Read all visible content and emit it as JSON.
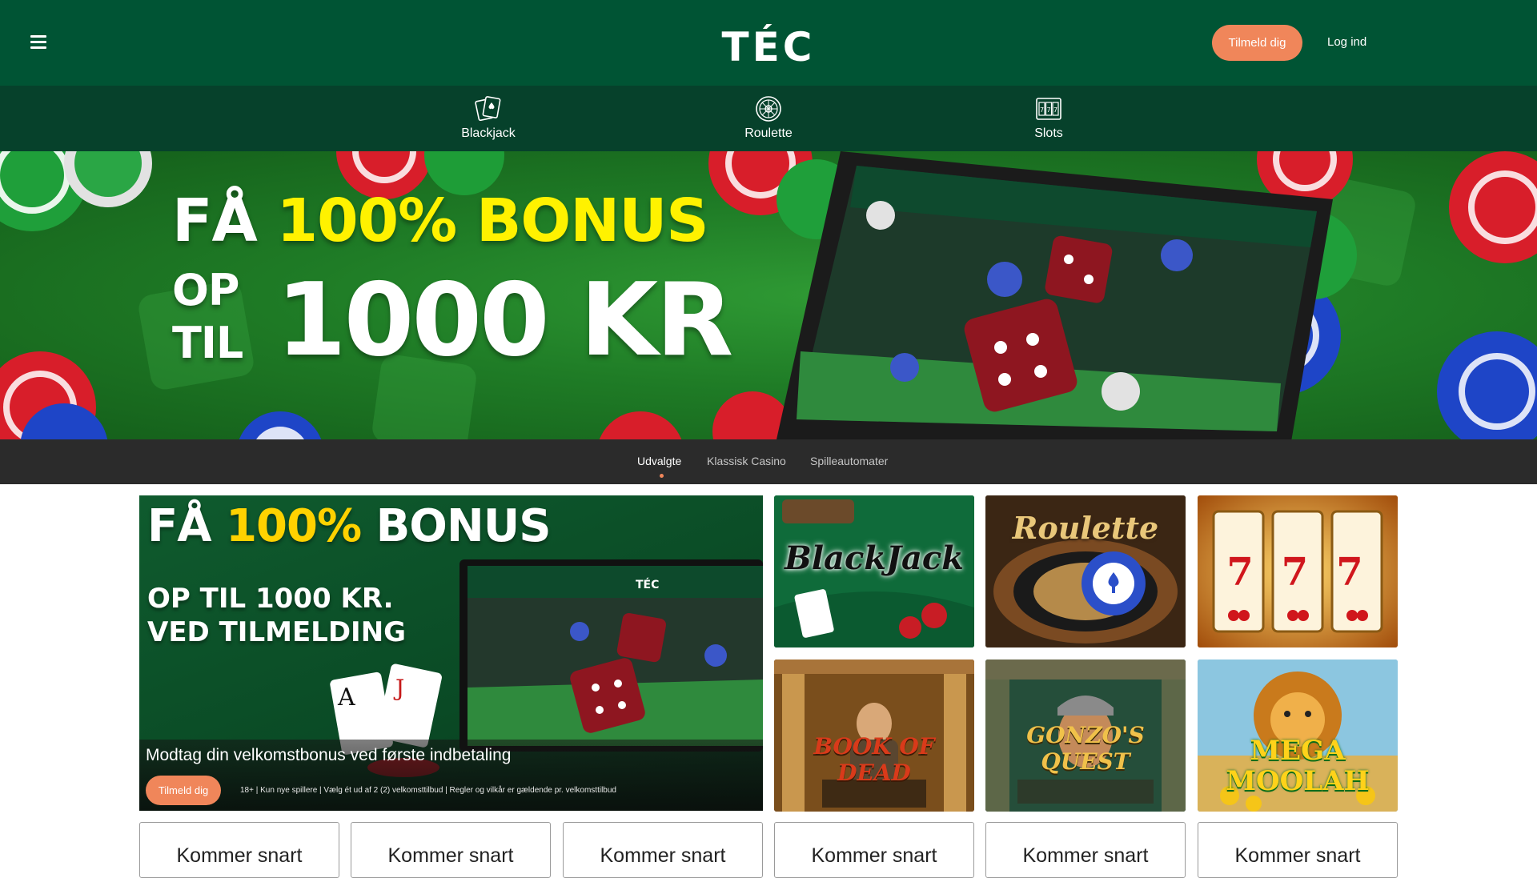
{
  "header": {
    "logo_text": "TÉC",
    "signup_label": "Tilmeld dig",
    "login_label": "Log ind"
  },
  "categories": [
    {
      "label": "Blackjack",
      "icon": "cards-icon"
    },
    {
      "label": "Roulette",
      "icon": "roulette-wheel-icon"
    },
    {
      "label": "Slots",
      "icon": "slot-machine-icon"
    }
  ],
  "hero": {
    "line1_white": "FÅ",
    "line1_yellow": "100% BONUS",
    "line2_small_a": "OP",
    "line2_small_b": "TIL",
    "line2_big": "1000 KR"
  },
  "tabs": [
    {
      "label": "Udvalgte",
      "active": true
    },
    {
      "label": "Klassisk Casino",
      "active": false
    },
    {
      "label": "Spilleautomater",
      "active": false
    }
  ],
  "promo": {
    "title_white": "FÅ",
    "title_yellow": "100%",
    "title_end": "BONUS",
    "sub_line1": "OP TIL 1000 KR.",
    "sub_line2": "VED TILMELDING",
    "caption": "Modtag din velkomstbonus ved første indbetaling",
    "signup_label": "Tilmeld dig",
    "terms": "18+ | Kun nye spillere | Vælg ét ud af 2 (2) velkomsttilbud | Regler og vilkår er gældende pr. velkomsttilbud"
  },
  "games": [
    {
      "title": "BlackJack"
    },
    {
      "title": "Roulette"
    },
    {
      "title": "777"
    },
    {
      "title": "BOOK OF DEAD"
    },
    {
      "title": "GONZO'S QUEST"
    },
    {
      "title": "MEGA MOOLAH"
    }
  ],
  "coming_soon": [
    "Kommer snart",
    "Kommer snart",
    "Kommer snart",
    "Kommer snart",
    "Kommer snart",
    "Kommer snart"
  ],
  "colors": {
    "header_bg": "#005434",
    "catnav_bg": "#06412b",
    "accent_orange": "#f0865a",
    "hero_yellow": "#fff200",
    "tabbar_bg": "#2b2b2b"
  }
}
